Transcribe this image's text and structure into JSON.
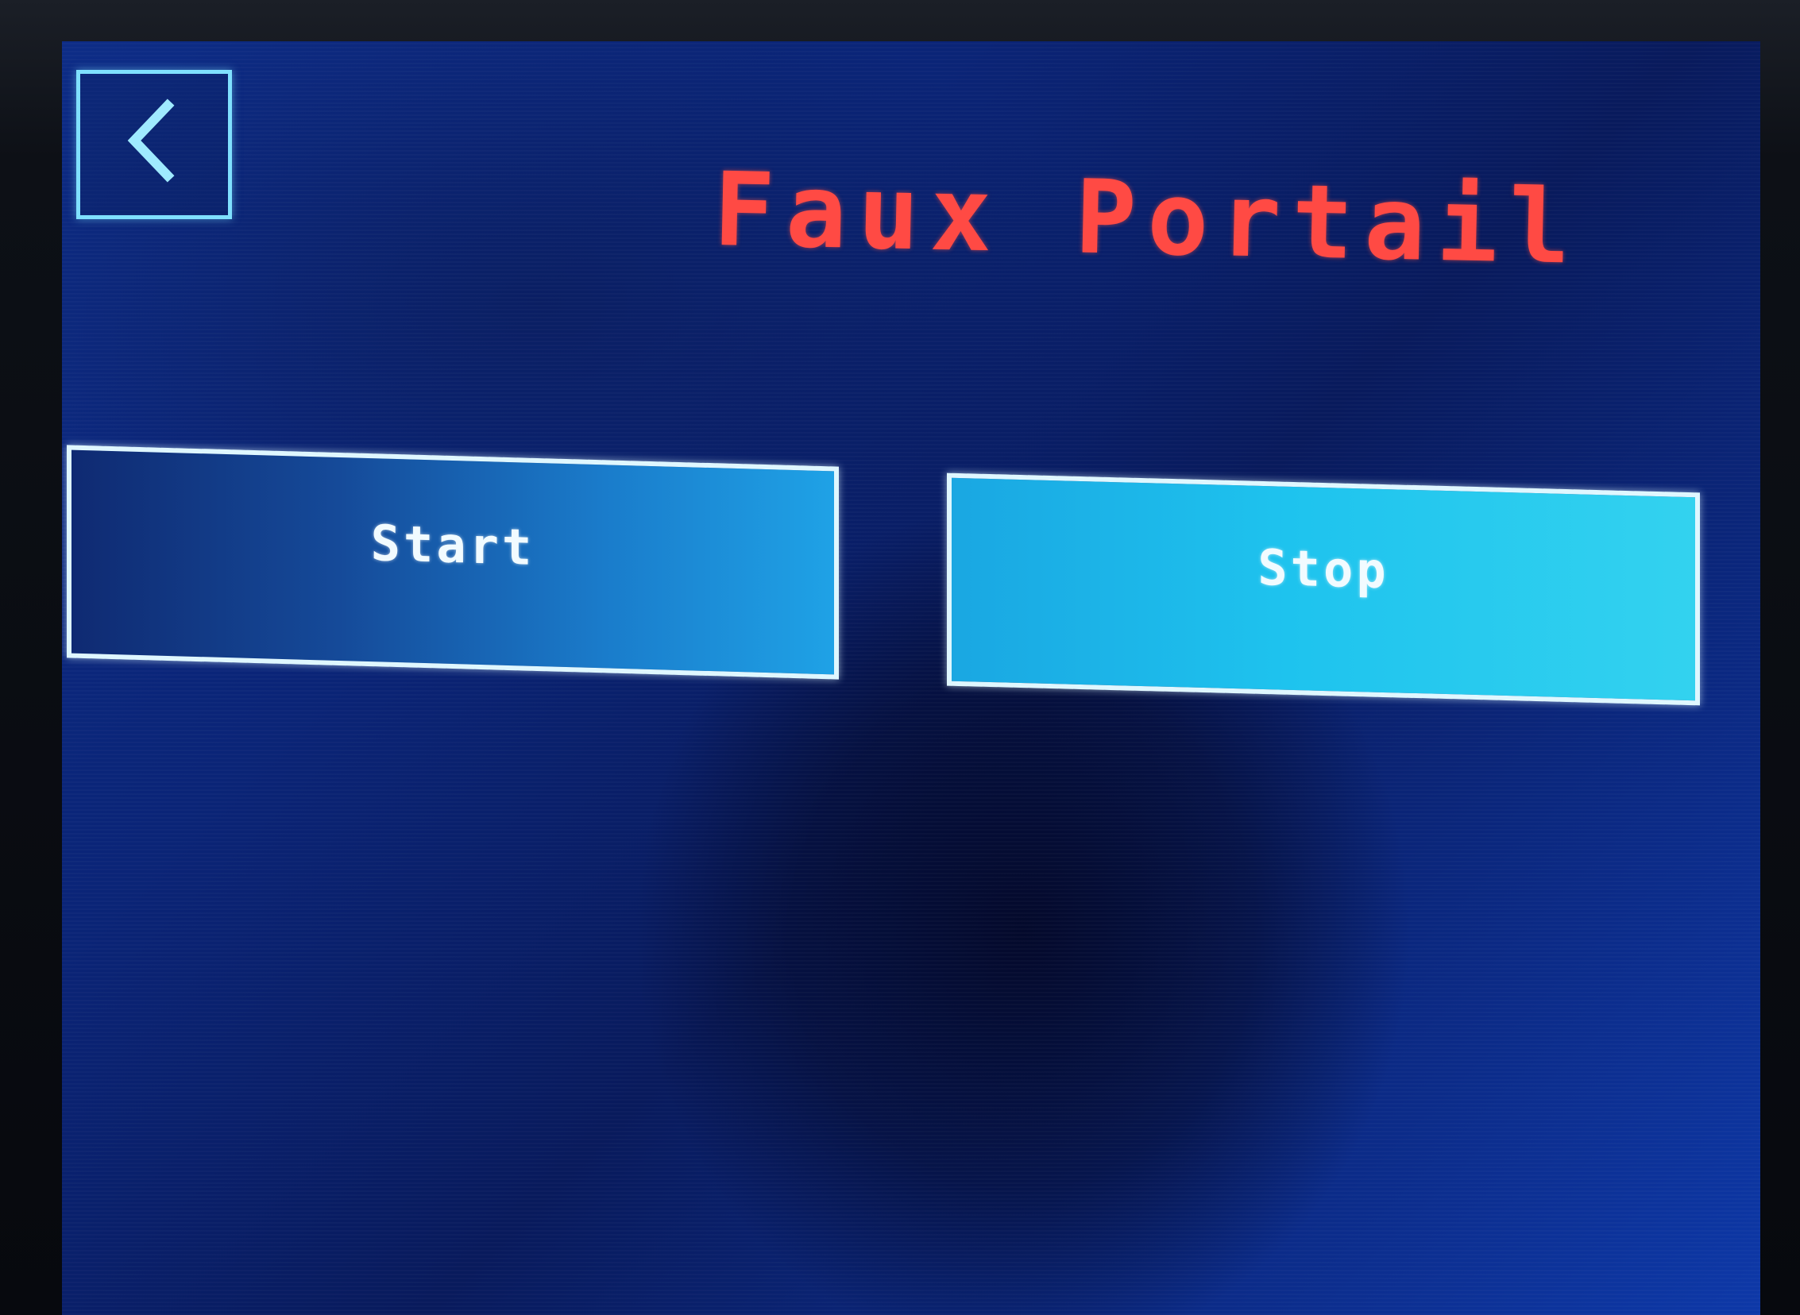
{
  "header": {
    "title": "Faux Portail",
    "back_icon": "chevron-left-icon"
  },
  "actions": {
    "start_label": "Start",
    "stop_label": "Stop"
  },
  "colors": {
    "background": "#0a2477",
    "title": "#ff4a44",
    "button_border": "#dff7ff",
    "back_border": "#7fe0ff",
    "start_fill": "#1a7ccb",
    "stop_fill": "#1ec3ee"
  }
}
